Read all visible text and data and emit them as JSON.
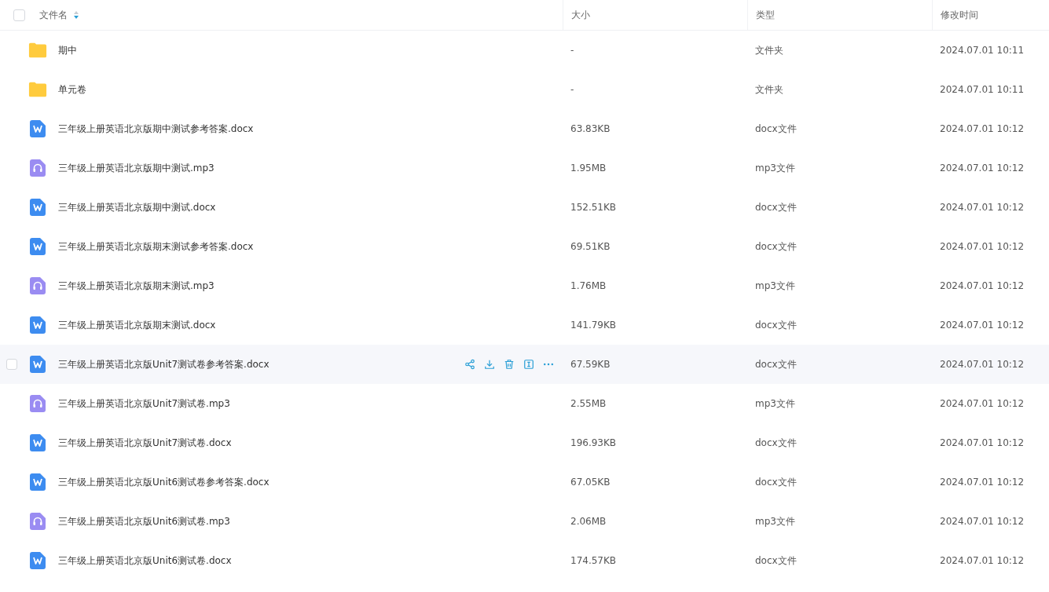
{
  "table": {
    "select_all": {
      "checked": false
    },
    "columns": [
      {
        "label": "文件名",
        "sortable": true
      },
      {
        "label": "大小",
        "sortable": false
      },
      {
        "label": "类型",
        "sortable": false
      },
      {
        "label": "修改时间",
        "sortable": false
      }
    ],
    "rows": [
      {
        "kind": "folder",
        "name": "期中",
        "size": "-",
        "type": "文件夹",
        "modified": "2024.07.01 10:11",
        "hovered": false
      },
      {
        "kind": "folder",
        "name": "单元卷",
        "size": "-",
        "type": "文件夹",
        "modified": "2024.07.01 10:11",
        "hovered": false
      },
      {
        "kind": "docx",
        "name": "三年级上册英语北京版期中测试参考答案.docx",
        "size": "63.83KB",
        "type": "docx文件",
        "modified": "2024.07.01 10:12",
        "hovered": false
      },
      {
        "kind": "mp3",
        "name": "三年级上册英语北京版期中测试.mp3",
        "size": "1.95MB",
        "type": "mp3文件",
        "modified": "2024.07.01 10:12",
        "hovered": false
      },
      {
        "kind": "docx",
        "name": "三年级上册英语北京版期中测试.docx",
        "size": "152.51KB",
        "type": "docx文件",
        "modified": "2024.07.01 10:12",
        "hovered": false
      },
      {
        "kind": "docx",
        "name": "三年级上册英语北京版期末测试参考答案.docx",
        "size": "69.51KB",
        "type": "docx文件",
        "modified": "2024.07.01 10:12",
        "hovered": false
      },
      {
        "kind": "mp3",
        "name": "三年级上册英语北京版期末测试.mp3",
        "size": "1.76MB",
        "type": "mp3文件",
        "modified": "2024.07.01 10:12",
        "hovered": false
      },
      {
        "kind": "docx",
        "name": "三年级上册英语北京版期末测试.docx",
        "size": "141.79KB",
        "type": "docx文件",
        "modified": "2024.07.01 10:12",
        "hovered": false
      },
      {
        "kind": "docx",
        "name": "三年级上册英语北京版Unit7测试卷参考答案.docx",
        "size": "67.59KB",
        "type": "docx文件",
        "modified": "2024.07.01 10:12",
        "hovered": true
      },
      {
        "kind": "mp3",
        "name": "三年级上册英语北京版Unit7测试卷.mp3",
        "size": "2.55MB",
        "type": "mp3文件",
        "modified": "2024.07.01 10:12",
        "hovered": false
      },
      {
        "kind": "docx",
        "name": "三年级上册英语北京版Unit7测试卷.docx",
        "size": "196.93KB",
        "type": "docx文件",
        "modified": "2024.07.01 10:12",
        "hovered": false
      },
      {
        "kind": "docx",
        "name": "三年级上册英语北京版Unit6测试卷参考答案.docx",
        "size": "67.05KB",
        "type": "docx文件",
        "modified": "2024.07.01 10:12",
        "hovered": false
      },
      {
        "kind": "mp3",
        "name": "三年级上册英语北京版Unit6测试卷.mp3",
        "size": "2.06MB",
        "type": "mp3文件",
        "modified": "2024.07.01 10:12",
        "hovered": false
      },
      {
        "kind": "docx",
        "name": "三年级上册英语北京版Unit6测试卷.docx",
        "size": "174.57KB",
        "type": "docx文件",
        "modified": "2024.07.01 10:12",
        "hovered": false
      }
    ]
  }
}
